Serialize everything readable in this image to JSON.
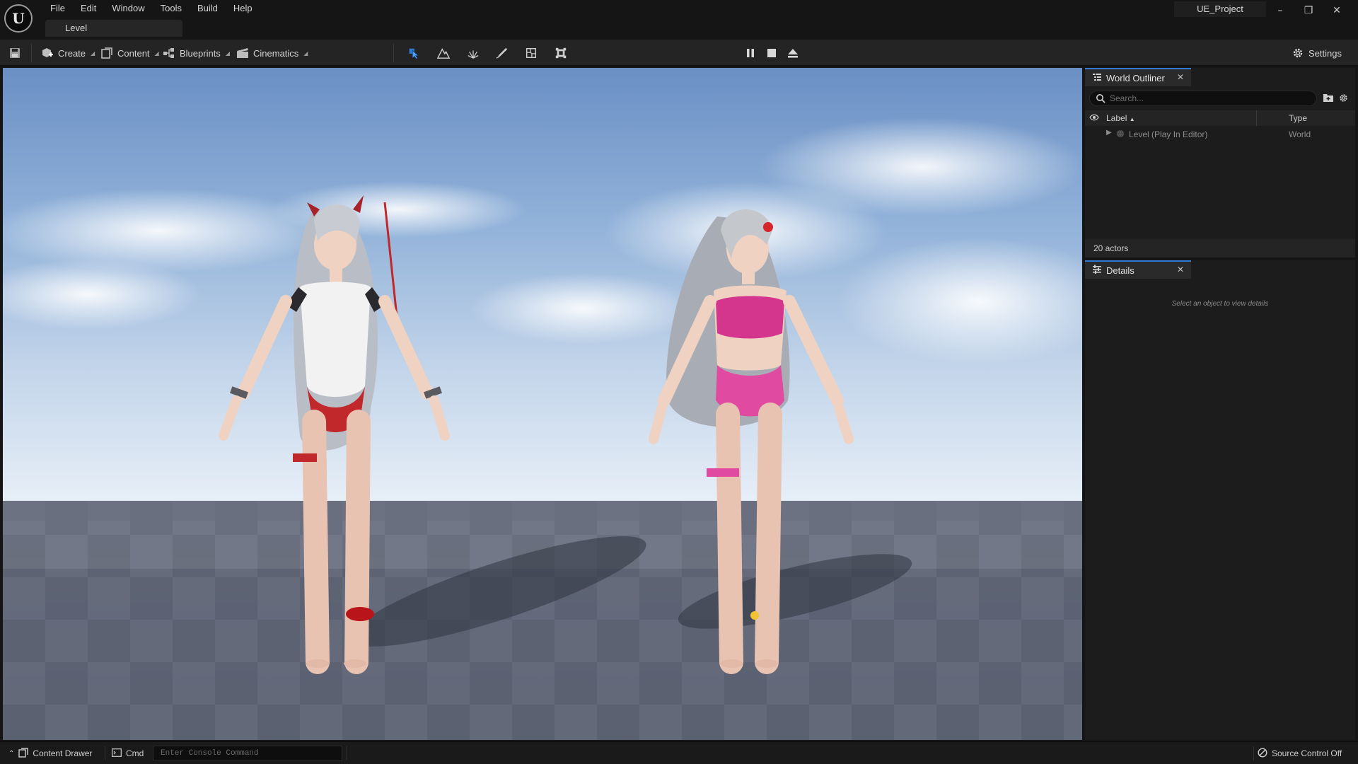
{
  "app": {
    "logo_text": "U",
    "project_name": "UE_Project",
    "level_tab": "Level"
  },
  "menu": [
    "File",
    "Edit",
    "Window",
    "Tools",
    "Build",
    "Help"
  ],
  "window_controls": {
    "minimize": "–",
    "restore": "❐",
    "close": "✕"
  },
  "toolbar": {
    "create_label": "Create",
    "content_label": "Content",
    "blueprints_label": "Blueprints",
    "cinematics_label": "Cinematics",
    "settings_label": "Settings",
    "mode_icons": [
      "select-mode-icon",
      "landscape-mode-icon",
      "foliage-mode-icon",
      "mesh-paint-mode-icon",
      "fracture-mode-icon",
      "modeling-mode-icon"
    ],
    "play_controls": [
      "pause-icon",
      "stop-icon",
      "eject-icon"
    ],
    "accent": "#2f7bd6"
  },
  "outliner": {
    "title": "World Outliner",
    "search_placeholder": "Search...",
    "col_label": "Label",
    "col_type": "Type",
    "rows": [
      {
        "label": "Level (Play In Editor)",
        "type": "World"
      }
    ],
    "actor_count": "20 actors"
  },
  "details": {
    "title": "Details",
    "hint": "Select an object to view details"
  },
  "statusbar": {
    "content_drawer": "Content Drawer",
    "cmd": "Cmd",
    "console_placeholder": "Enter Console Command",
    "source_control": "Source Control Off"
  }
}
